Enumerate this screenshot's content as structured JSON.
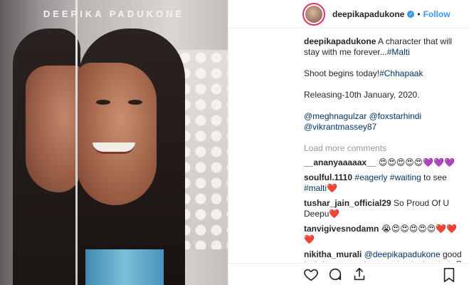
{
  "photo": {
    "brand_text": "DEEPIKA PADUKONE"
  },
  "header": {
    "username": "deepikapadukone",
    "separator": "•",
    "follow_label": "Follow"
  },
  "caption": {
    "username": "deepikapadukone",
    "line1": " A character that will stay with me forever...",
    "tag1": "#Malti",
    "line2": "Shoot begins today!",
    "tag2": "#Chhapaak",
    "line3": "Releasing-10th January, 2020.",
    "mention1": "@meghnagulzar",
    "mention2": "@foxstarhindi",
    "mention3": "@vikrantmassey87"
  },
  "load_more": "Load more comments",
  "comments": [
    {
      "user": "__ananyaaaaax__",
      "text": " 😍😍😍😍😍💜💜💜"
    },
    {
      "user": "soulful.1110",
      "text_pre": " ",
      "tag_a": "#eagerly",
      "mid": " ",
      "tag_b": "#waiting",
      "post": " to see ",
      "tag_c": "#malti",
      "end": "❤️"
    },
    {
      "user": "tushar_jain_official29",
      "text": " So Proud Of U Deepu❤️"
    },
    {
      "user": "tanvigivesnodamn",
      "text": " 😭😍😍😍😍😍❤️❤️❤️"
    },
    {
      "user": "nikitha_murali",
      "mention": "@deepikapadukone",
      "text": " good luck for yet another new beginning, lady😄"
    }
  ],
  "icons": {
    "like": "heart-icon",
    "comment": "comment-icon",
    "share": "share-icon",
    "save": "bookmark-icon"
  }
}
